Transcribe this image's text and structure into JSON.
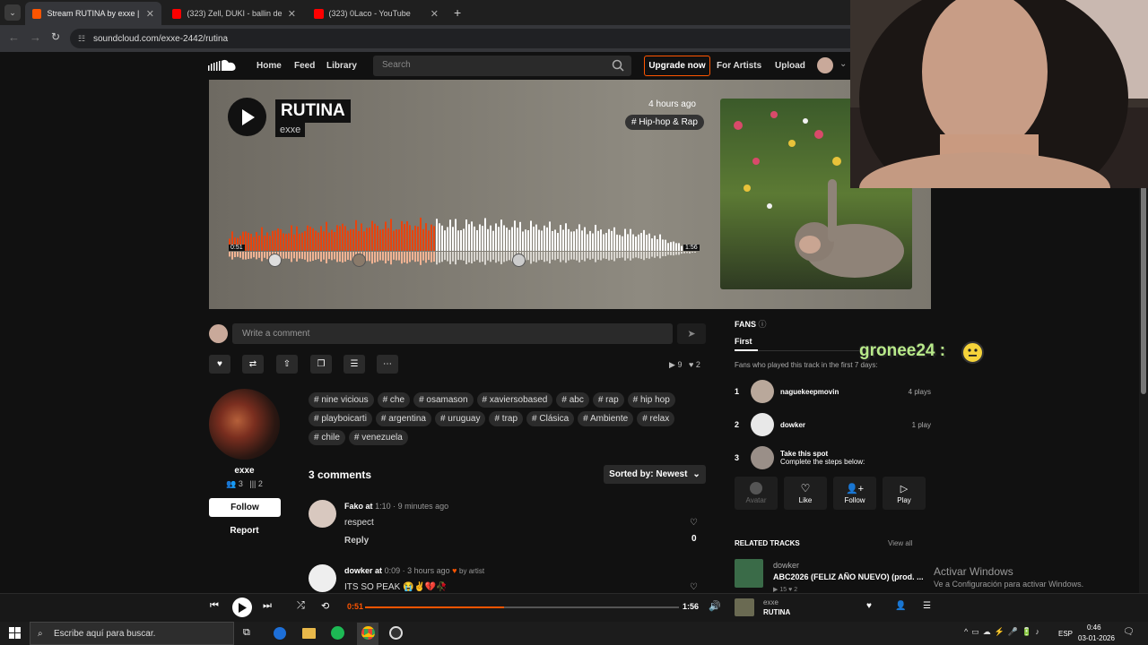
{
  "browser": {
    "tabs": [
      {
        "title": "Stream RUTINA by exxe | Listen",
        "active": true,
        "favicon_color": "#ff5500"
      },
      {
        "title": "(323) Zell, DUKI - ballin de verd",
        "active": false,
        "favicon_color": "#ff0000"
      },
      {
        "title": "(323) 0Laco - YouTube",
        "active": false,
        "favicon_color": "#ff0000"
      }
    ],
    "new_tab": "+",
    "url": "soundcloud.com/exxe-2442/rutina"
  },
  "header": {
    "nav": [
      "Home",
      "Feed",
      "Library"
    ],
    "search_placeholder": "Search",
    "upgrade": "Upgrade now",
    "for_artists": "For Artists",
    "upload": "Upload"
  },
  "track": {
    "title": "RUTINA",
    "artist": "exxe",
    "time_ago": "4 hours ago",
    "genre": "# Hip-hop & Rap",
    "elapsed": "0:51",
    "duration": "1:56",
    "progress": 0.44
  },
  "comment_box": {
    "placeholder": "Write a comment"
  },
  "stats": {
    "plays": "9",
    "likes": "2"
  },
  "artist_block": {
    "name": "exxe",
    "followers": "3",
    "tracks": "2",
    "follow": "Follow",
    "report": "Report"
  },
  "tags": [
    "# nine vicious",
    "# che",
    "# osamason",
    "# xaviersobased",
    "# abc",
    "# rap",
    "# hip hop",
    "# playboicarti",
    "# argentina",
    "# uruguay",
    "# trap",
    "# Clásica",
    "# Ambiente",
    "# relax",
    "# chile",
    "# venezuela"
  ],
  "comments": {
    "count_label": "3 comments",
    "sort_label": "Sorted by: Newest",
    "items": [
      {
        "user": "Fako",
        "at": "at",
        "timestamp": "1:10",
        "ago": "· 9 minutes ago",
        "text": "respect",
        "reply": "Reply",
        "likes": "0"
      },
      {
        "user": "dowker",
        "at": "at",
        "timestamp": "0:09",
        "ago": "· 3 hours ago",
        "by_artist": "by artist",
        "text": "ITS SO PEAK 😭✌️💔🥀"
      }
    ]
  },
  "fans": {
    "heading": "FANS",
    "tab": "First",
    "description": "Fans who played this track in the first 7 days:",
    "rows": [
      {
        "rank": "1",
        "name": "naguekeepmovin",
        "plays": "4 plays"
      },
      {
        "rank": "2",
        "name": "dowker",
        "plays": "1 play"
      }
    ],
    "spot": {
      "rank": "3",
      "title": "Take this spot",
      "subtitle": "Complete the steps below:"
    },
    "steps": [
      "Avatar",
      "Like",
      "Follow",
      "Play"
    ]
  },
  "related": {
    "heading": "RELATED TRACKS",
    "view_all": "View all",
    "item": {
      "artist": "dowker",
      "title": "ABC2026 (FELIZ AÑO NUEVO) (prod. ...",
      "plays": "15",
      "likes": "2"
    }
  },
  "windows_watermark": {
    "line1": "Activar Windows",
    "line2": "Ve a Configuración para activar Windows."
  },
  "player": {
    "elapsed": "0:51",
    "duration": "1:56",
    "progress": 0.44,
    "artist": "exxe",
    "title": "RUTINA"
  },
  "overlay": {
    "chat_user": "gronee24",
    "chat_sep": ":"
  },
  "taskbar": {
    "search_placeholder": "Escribe aquí para buscar.",
    "lang": "ESP",
    "time": "0:46",
    "date": "03-01-2026"
  },
  "colors": {
    "accent": "#ff5500",
    "wave_played": "#e8440e",
    "wave_unplayed": "#ffffff"
  }
}
